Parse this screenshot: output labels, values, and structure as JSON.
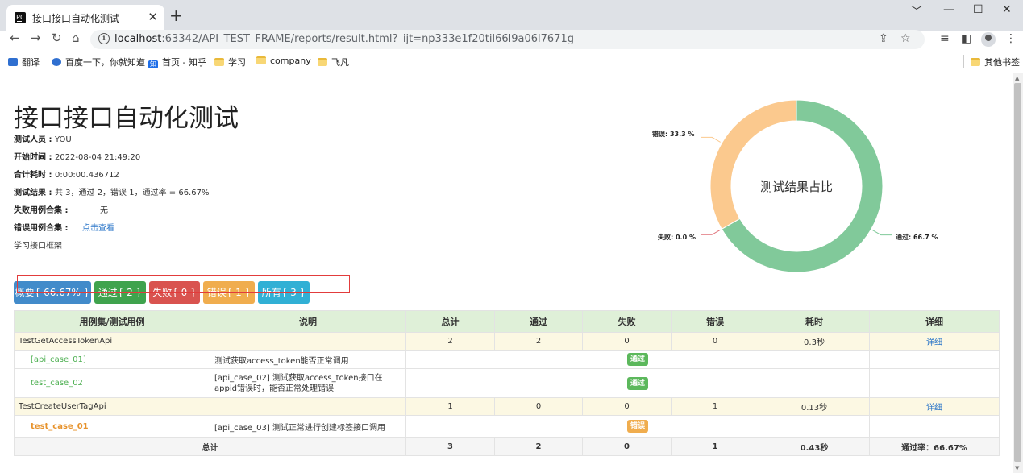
{
  "browser": {
    "tab_title": "接口接口自动化测试",
    "tab_close": "✕",
    "new_tab": "+",
    "url_host": "localhost",
    "url_rest": ":63342/API_TEST_FRAME/reports/result.html?_ijt=np333e1f20til66l9a06l7671g",
    "win_min": "﹀",
    "win_minimize": "—",
    "win_max": "☐",
    "win_close": "✕",
    "bookmarks": [
      {
        "label": "翻译",
        "icon": "translate-icon"
      },
      {
        "label": "百度一下，你就知道",
        "icon": "baidu-icon"
      },
      {
        "label": "首页 - 知乎",
        "icon": "zhihu-icon"
      },
      {
        "label": "学习",
        "icon": "folder-icon"
      },
      {
        "label": "company",
        "icon": "folder-icon"
      },
      {
        "label": "飞凡",
        "icon": "folder-icon"
      }
    ],
    "other_bookmarks": "其他书签"
  },
  "report": {
    "title": "接口接口自动化测试",
    "tester_label": "测试人员 : ",
    "tester": "YOU",
    "start_label": "开始时间 : ",
    "start": "2022-08-04 21:49:20",
    "duration_label": "合计耗时 : ",
    "duration": "0:00:00.436712",
    "result_label": "测试结果 : ",
    "result": "共 3，通过 2，错误 1，通过率 = 66.67%",
    "fail_set_label": "失败用例合集 : ",
    "fail_set": "无",
    "err_set_label": "错误用例合集 : ",
    "err_set": "点击查看",
    "description": "学习接口框架"
  },
  "filters": [
    {
      "label": "概要{ 66.67% }",
      "color": "#428bca"
    },
    {
      "label": "通过{ 2 }",
      "color": "#3fa34d"
    },
    {
      "label": "失败{ 0 }",
      "color": "#d9534f"
    },
    {
      "label": "错误{ 1 }",
      "color": "#f0ad4e"
    },
    {
      "label": "所有{ 3 }",
      "color": "#31b0d5"
    }
  ],
  "chart_data": {
    "type": "pie",
    "title": "测试结果占比",
    "series": [
      {
        "name": "通过",
        "value": 66.7,
        "color": "#81c99a",
        "label": "通过: 66.7 %"
      },
      {
        "name": "失败",
        "value": 0.0,
        "color": "#e0727a",
        "label": "失败: 0.0 %"
      },
      {
        "name": "错误",
        "value": 33.3,
        "color": "#fbc98e",
        "label": "错误: 33.3 %"
      }
    ]
  },
  "table": {
    "headers": [
      "用例集/测试用例",
      "说明",
      "总计",
      "通过",
      "失败",
      "错误",
      "耗时",
      "详细"
    ],
    "suite1": {
      "name": "TestGetAccessTokenApi",
      "desc": "",
      "total": "2",
      "pass": "2",
      "fail": "0",
      "error": "0",
      "time": "0.3秒",
      "detail": "详细"
    },
    "case1": {
      "name": "[api_case_01]",
      "desc": "测试获取access_token能否正常调用",
      "status": "通过"
    },
    "case2": {
      "name": "test_case_02",
      "desc": "[api_case_02] 测试获取access_token接口在appid错误时，能否正常处理错误",
      "status": "通过"
    },
    "suite2": {
      "name": "TestCreateUserTagApi",
      "desc": "",
      "total": "1",
      "pass": "0",
      "fail": "0",
      "error": "1",
      "time": "0.13秒",
      "detail": "详细"
    },
    "case3": {
      "name": "test_case_01",
      "desc": "[api_case_03] 测试正常进行创建标签接口调用",
      "status": "错误"
    },
    "total": {
      "label": "总计",
      "total": "3",
      "pass": "2",
      "fail": "0",
      "error": "1",
      "time": "0.43秒",
      "rate": "通过率：66.67%"
    }
  }
}
